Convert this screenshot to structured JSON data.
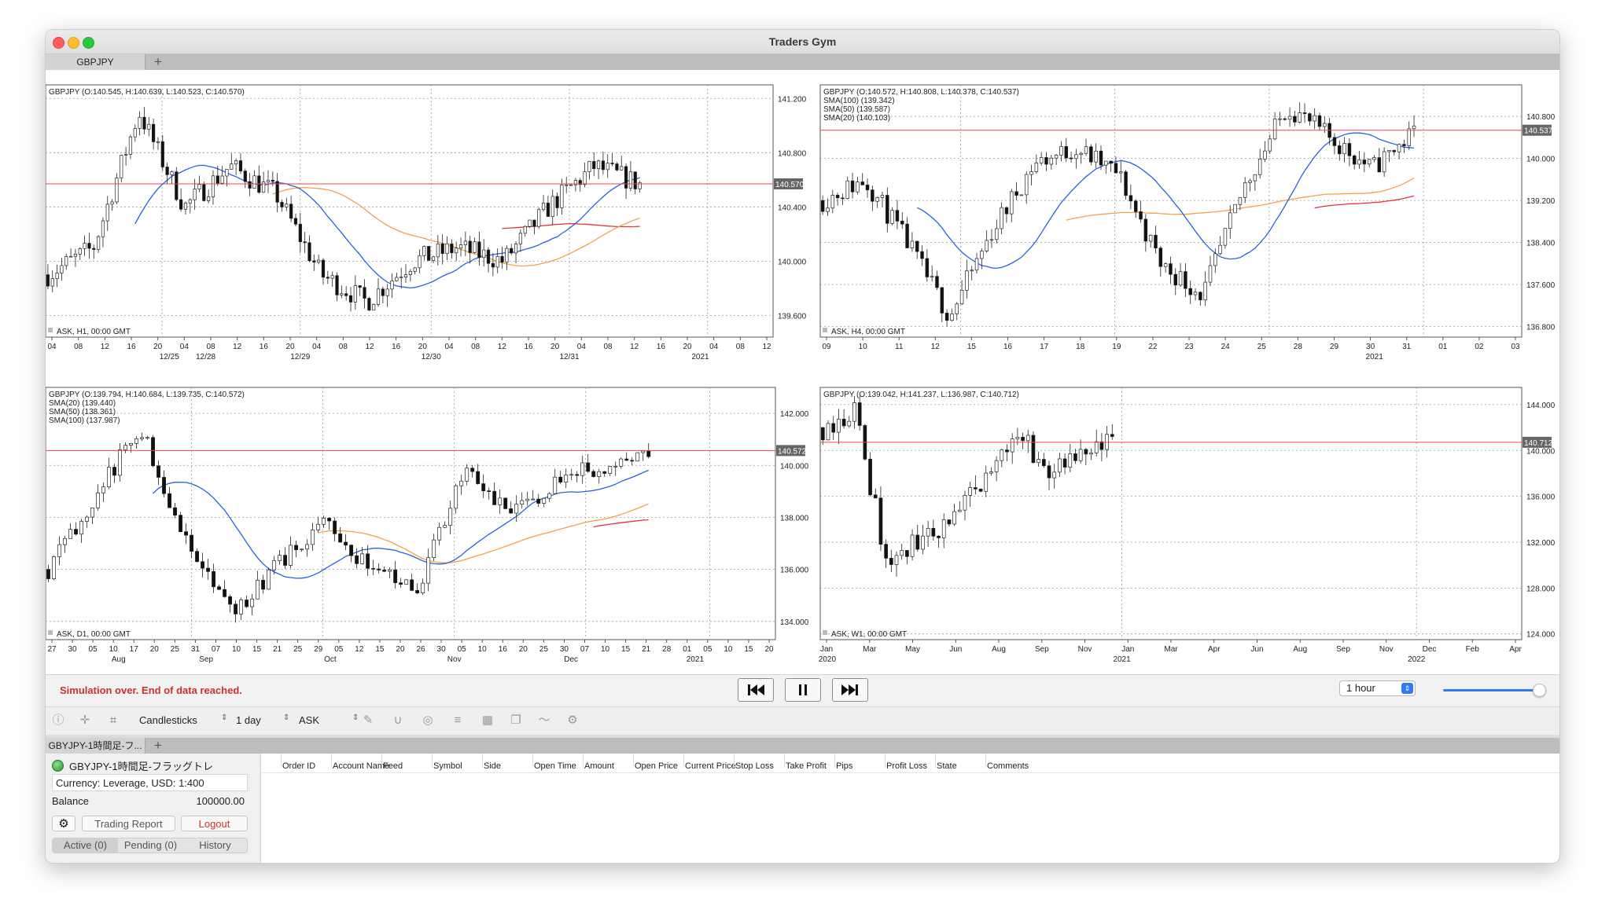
{
  "window": {
    "title": "Traders Gym"
  },
  "top_tabs": [
    {
      "label": "GBPJPY"
    }
  ],
  "charts": {
    "h1": {
      "info": "GBPJPY (O:140.545, H:140.639, L:140.523, C:140.570)",
      "footer": "ASK, H1, 00:00 GMT",
      "price_tag": "140.570",
      "yticks": [
        "141.200",
        "140.800",
        "140.400",
        "140.000",
        "139.600"
      ],
      "xticks": [
        "04",
        "08",
        "12",
        "16",
        "20",
        "04",
        "08",
        "12",
        "16",
        "20",
        "04",
        "08",
        "12",
        "16",
        "20",
        "04",
        "08",
        "12",
        "16",
        "20",
        "04",
        "08",
        "12",
        "16",
        "20",
        "04",
        "08",
        "12"
      ],
      "xdates": [
        "12/25",
        "12/28",
        "12/29",
        "12/30",
        "12/31",
        "2021"
      ]
    },
    "h4": {
      "info": "GBPJPY (O:140.572, H:140.808, L:140.378, C:140.537)",
      "indicators": [
        "SMA(100) (139.342)",
        "SMA(50) (139.587)",
        "SMA(20) (140.103)"
      ],
      "footer": "ASK, H4, 00:00 GMT",
      "price_tag": "140.537",
      "yticks": [
        "140.800",
        "140.000",
        "139.200",
        "138.400",
        "137.600",
        "136.800"
      ],
      "xticks": [
        "09",
        "10",
        "11",
        "12",
        "15",
        "16",
        "17",
        "18",
        "19",
        "22",
        "23",
        "24",
        "25",
        "28",
        "29",
        "30",
        "31",
        "01",
        "02",
        "03"
      ],
      "xdates": [
        "2021"
      ]
    },
    "d1": {
      "info": "GBPJPY (O:139.794, H:140.684, L:139.735, C:140.572)",
      "indicators": [
        "SMA(20) (139.440)",
        "SMA(50) (138.361)",
        "SMA(100) (137.987)"
      ],
      "footer": "ASK, D1, 00:00 GMT",
      "price_tag": "140.572",
      "yticks": [
        "142.000",
        "140.000",
        "138.000",
        "136.000",
        "134.000"
      ],
      "xticks": [
        "27",
        "30",
        "05",
        "10",
        "17",
        "20",
        "25",
        "31",
        "07",
        "10",
        "15",
        "21",
        "25",
        "29",
        "05",
        "12",
        "15",
        "20",
        "26",
        "30",
        "05",
        "10",
        "16",
        "20",
        "25",
        "30",
        "07",
        "10",
        "15",
        "21",
        "28",
        "01",
        "05",
        "10",
        "15",
        "20"
      ],
      "xmonths": [
        "Aug",
        "Sep",
        "Oct",
        "Nov",
        "Dec",
        "2021"
      ]
    },
    "w1": {
      "info": "GBPJPY (O:139.042, H:141.237, L:136.987, C:140.712)",
      "footer": "ASK, W1, 00:00 GMT",
      "price_tag": "140.712",
      "yticks": [
        "144.000",
        "140.000",
        "136.000",
        "132.000",
        "128.000",
        "124.000"
      ],
      "xticks": [
        "Jan",
        "Mar",
        "May",
        "Jun",
        "Aug",
        "Sep",
        "Nov",
        "Jan",
        "Mar",
        "Apr",
        "Jun",
        "Aug",
        "Sep",
        "Nov",
        "Dec",
        "Feb",
        "Apr"
      ],
      "xyears": [
        "2020",
        "2021",
        "2022"
      ]
    }
  },
  "status": {
    "message": "Simulation over. End of data reached."
  },
  "playback": {
    "timeframe": "1 hour"
  },
  "toolbar": {
    "chart_type": "Candlesticks",
    "period": "1 day",
    "price_side": "ASK"
  },
  "bottom_tabs": [
    {
      "label": "GBYJPY-1時間足-フ..."
    }
  ],
  "account": {
    "name": "GBYJPY-1時間足-フラッグトレ",
    "currency": "Currency: Leverage, USD: 1:400",
    "balance_label": "Balance",
    "balance_value": "100000.00",
    "trading_report": "Trading Report",
    "logout": "Logout",
    "tabs": [
      "Active (0)",
      "Pending (0)",
      "History"
    ]
  },
  "orders_table": {
    "columns": [
      "Order ID",
      "Account Name",
      "Feed",
      "Symbol",
      "Side",
      "Open Time",
      "Amount",
      "Open Price",
      "Current Price",
      "Stop Loss",
      "Take Profit",
      "Pips",
      "Profit Loss",
      "State",
      "Comments"
    ],
    "rows": []
  },
  "colors": {
    "sma20": "#2563e0",
    "sma50": "#f5a04a",
    "sma100": "#e8323a",
    "price_line": "#f0444a",
    "status": "#d0302a"
  }
}
